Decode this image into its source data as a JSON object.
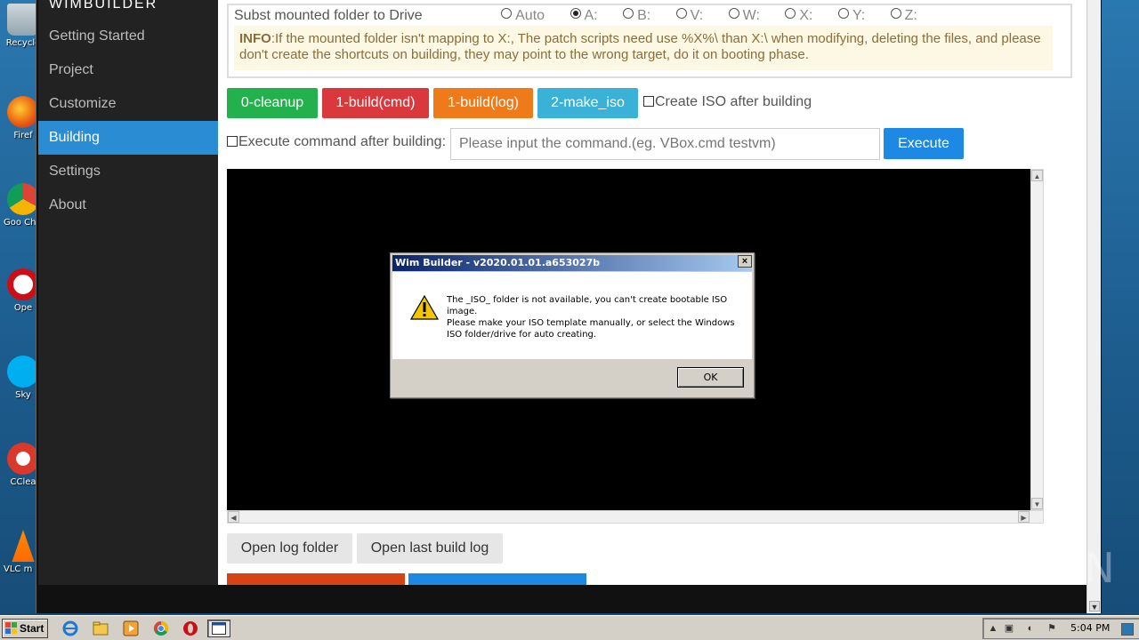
{
  "desktop": {
    "icons": [
      {
        "name": "recycle-bin",
        "label": "Recycle"
      },
      {
        "name": "firefox",
        "label": "Firef"
      },
      {
        "name": "chrome",
        "label": "Goo Chro"
      },
      {
        "name": "opera",
        "label": "Ope"
      },
      {
        "name": "skype",
        "label": "Sky"
      },
      {
        "name": "ccleaner",
        "label": "CClea"
      },
      {
        "name": "vlc",
        "label": "VLC m play"
      }
    ]
  },
  "app": {
    "brand": "WIMBUILDER",
    "nav": [
      {
        "label": "Getting Started",
        "active": false
      },
      {
        "label": "Project",
        "active": false
      },
      {
        "label": "Customize",
        "active": false
      },
      {
        "label": "Building",
        "active": true
      },
      {
        "label": "Settings",
        "active": false
      },
      {
        "label": "About",
        "active": false
      }
    ],
    "subst": {
      "label": "Subst mounted folder to Drive",
      "options": [
        "Auto",
        "A:",
        "B:",
        "V:",
        "W:",
        "X:",
        "Y:",
        "Z:"
      ],
      "selected": "A:"
    },
    "info": {
      "prefix": "INFO",
      "text": ":If the mounted folder isn't mapping to X:, The patch scripts need use %X%\\ than X:\\ when modifying, deleting the files, and please don't create the shortcuts on building, they may point to the wrong target, do it on booting phase."
    },
    "buttons": {
      "cleanup": "0-cleanup",
      "build_cmd": "1-build(cmd)",
      "build_log": "1-build(log)",
      "make_iso": "2-make_iso",
      "execute": "Execute",
      "open_log_folder": "Open log folder",
      "open_last_build_log": "Open last build log"
    },
    "create_iso_label": "Create ISO after building",
    "exec_after_label": "Execute command after building:",
    "command_placeholder": "Please input the command.(eg. VBox.cmd testvm)"
  },
  "dialog": {
    "title": "Wim Builder - v2020.01.01.a653027b",
    "close": "×",
    "line1": "The _ISO_ folder is not available, you can't create bootable ISO image.",
    "line2": "Please make your ISO template manually, or select the Windows ISO folder/drive for auto creating.",
    "ok": "OK"
  },
  "taskbar": {
    "start": "Start",
    "clock": "5:04 PM"
  },
  "watermark": "ANY RUN"
}
